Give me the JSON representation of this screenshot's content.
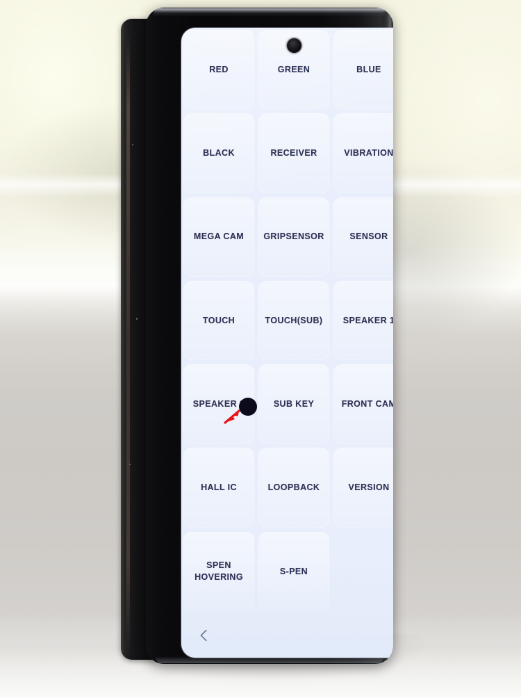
{
  "device": {
    "name": "samsung-galaxy-z-fold-folded",
    "screen_bg": "#e8eefb",
    "label_color": "#2c3054",
    "body_color": "#0b0b0d"
  },
  "screen": {
    "camera_icon": "front-camera-punch-hole",
    "nav": {
      "back_icon": "chevron-left-icon",
      "back_label": "Back"
    }
  },
  "grid": {
    "columns": 3,
    "rows": 7,
    "buttons": [
      {
        "label": "RED",
        "empty": false
      },
      {
        "label": "GREEN",
        "empty": false
      },
      {
        "label": "BLUE",
        "empty": false
      },
      {
        "label": "BLACK",
        "empty": false
      },
      {
        "label": "RECEIVER",
        "empty": false
      },
      {
        "label": "VIBRATION",
        "empty": false
      },
      {
        "label": "MEGA CAM",
        "empty": false
      },
      {
        "label": "GRIPSENSOR",
        "empty": false
      },
      {
        "label": "SENSOR",
        "empty": false
      },
      {
        "label": "TOUCH",
        "empty": false
      },
      {
        "label": "TOUCH(SUB)",
        "empty": false
      },
      {
        "label": "SPEAKER 1",
        "empty": false
      },
      {
        "label": "SPEAKER 2",
        "empty": false
      },
      {
        "label": "SUB KEY",
        "empty": false
      },
      {
        "label": "FRONT CAM",
        "empty": false
      },
      {
        "label": "HALL IC",
        "empty": false
      },
      {
        "label": "LOOPBACK",
        "empty": false
      },
      {
        "label": "VERSION",
        "empty": false
      },
      {
        "label": "SPEN\nHOVERING",
        "empty": false
      },
      {
        "label": "S-PEN",
        "empty": false
      },
      {
        "label": "",
        "empty": true
      }
    ]
  },
  "annotation": {
    "dot_color": "#0b0b1c",
    "arrow_color": "#e8141c",
    "target_label": "SUB KEY"
  },
  "hardware": {
    "volume_button": "volume-rocker",
    "power_button": "power-fingerprint-button",
    "speaker": "bottom-speaker-grille",
    "usb_port": "usb-c-port"
  }
}
